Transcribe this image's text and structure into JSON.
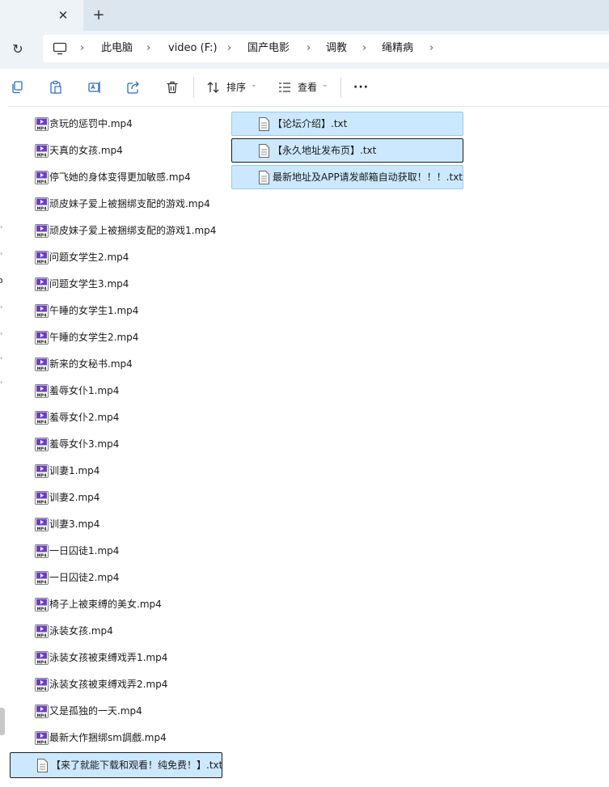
{
  "tab": {
    "close_glyph": "✕",
    "new_tab_glyph": "+"
  },
  "address": {
    "refresh_glyph": "↻",
    "breadcrumbs": [
      "此电脑",
      "video (F:)",
      "国产电影",
      "调教",
      "绳精病"
    ],
    "separator": "›"
  },
  "toolbar": {
    "sort_label": "排序",
    "view_label": "查看",
    "more_label": "···",
    "chevron": "⌄",
    "icons": [
      "copy-icon",
      "paste-icon",
      "rename-icon",
      "share-icon",
      "delete-icon",
      "sort-icon",
      "view-icon",
      "more-icon"
    ]
  },
  "files": {
    "mp4": [
      "贪玩的惩罚中.mp4",
      "天真的女孩.mp4",
      "停飞她的身体变得更加敏感.mp4",
      "顽皮妹子爱上被捆绑支配的游戏.mp4",
      "顽皮妹子爱上被捆绑支配的游戏1.mp4",
      "问题女学生2.mp4",
      "问题女学生3.mp4",
      "午睡的女学生1.mp4",
      "午睡的女学生2.mp4",
      "新来的女秘书.mp4",
      "羞辱女仆1.mp4",
      "羞辱女仆2.mp4",
      "羞辱女仆3.mp4",
      "训妻1.mp4",
      "训妻2.mp4",
      "训妻3.mp4",
      "一日囚徒1.mp4",
      "一日囚徒2.mp4",
      "椅子上被束缚的美女.mp4",
      "泳装女孩.mp4",
      "泳装女孩被束缚戏弄1.mp4",
      "泳装女孩被束缚戏弄2.mp4",
      "又是孤独的一天.mp4",
      "最新大作捆绑sm調戲.mp4"
    ],
    "txt_top": [
      "【论坛介绍】.txt",
      "【永久地址发布页】.txt",
      "最新地址及APP请发邮箱自动获取！！！.txt"
    ],
    "txt_bottom": "【来了就能下载和观看！纯免费！】.txt"
  },
  "colors": {
    "selection_bg": "#cce8ff",
    "selection_border": "#99c9f2",
    "focus_border": "#1b1b1b",
    "mp4_icon": "#6b3fc2",
    "header_bg": "#eef3f8",
    "tabstrip_bg": "#dce6ee"
  }
}
